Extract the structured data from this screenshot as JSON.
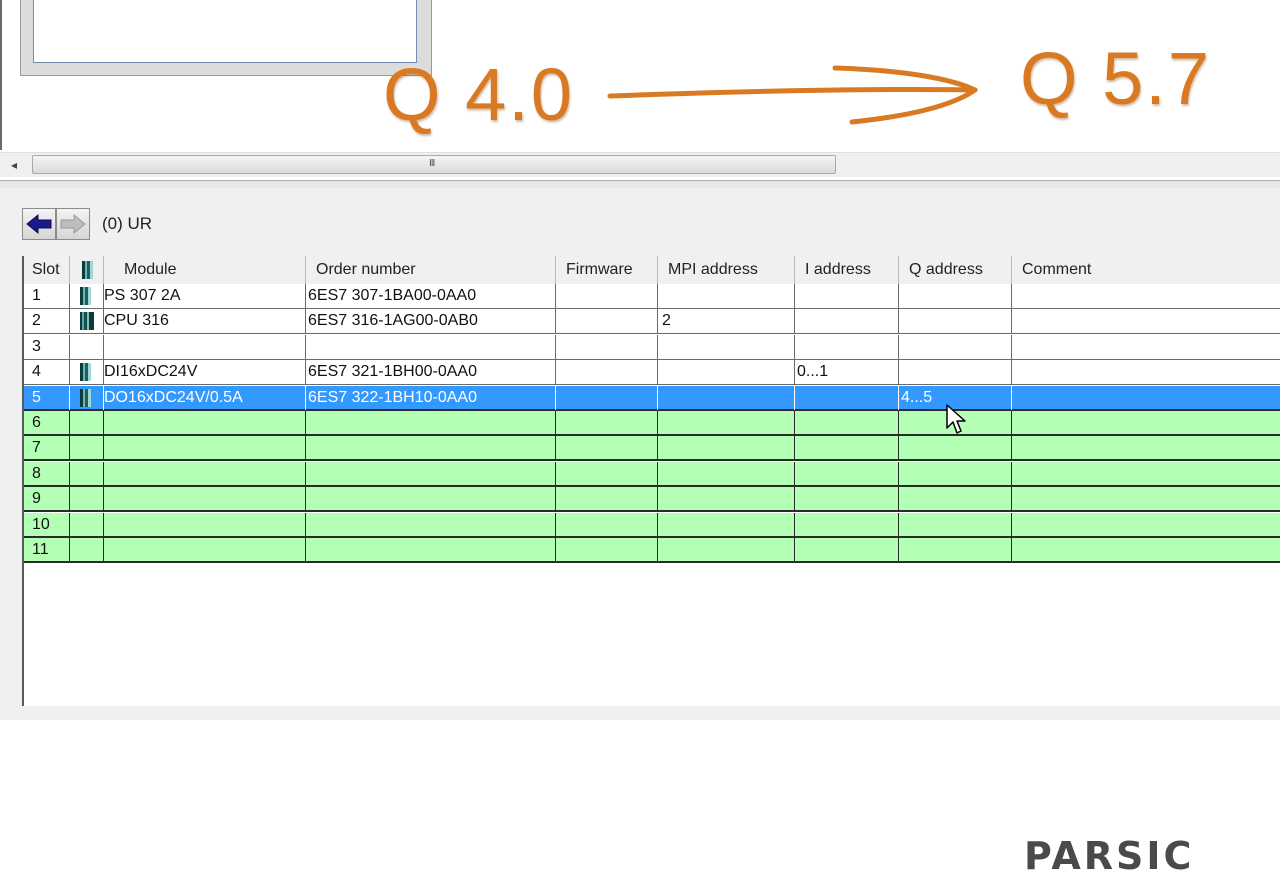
{
  "overlay": {
    "start_label": "Q 4.0",
    "end_label": "Q 5.7",
    "accent_color": "#d97a22"
  },
  "scrollbar": {
    "left_arrow": "◂",
    "grip": "III"
  },
  "nav": {
    "back_icon": "arrow-left-icon",
    "forward_icon": "arrow-right-icon",
    "rack_label": "(0)  UR"
  },
  "table": {
    "columns": [
      "Slot",
      "",
      "Module",
      "Order number",
      "Firmware",
      "MPI address",
      "I address",
      "Q address",
      "Comment"
    ],
    "rows": [
      {
        "slot": "1",
        "icon": "module-icon",
        "module": "PS 307 2A",
        "order": "6ES7 307-1BA00-0AA0",
        "firmware": "",
        "mpi": "",
        "i_addr": "",
        "q_addr": "",
        "comment": "",
        "state": "occupied"
      },
      {
        "slot": "2",
        "icon": "cpu-module-icon",
        "module": "CPU 316",
        "order": "6ES7 316-1AG00-0AB0",
        "firmware": "",
        "mpi": "2",
        "i_addr": "",
        "q_addr": "",
        "comment": "",
        "state": "occupied"
      },
      {
        "slot": "3",
        "icon": "",
        "module": "",
        "order": "",
        "firmware": "",
        "mpi": "",
        "i_addr": "",
        "q_addr": "",
        "comment": "",
        "state": "occupied"
      },
      {
        "slot": "4",
        "icon": "module-icon",
        "module": "DI16xDC24V",
        "order": "6ES7 321-1BH00-0AA0",
        "firmware": "",
        "mpi": "",
        "i_addr": "0...1",
        "q_addr": "",
        "comment": "",
        "state": "occupied"
      },
      {
        "slot": "5",
        "icon": "module-icon",
        "module": "DO16xDC24V/0.5A",
        "order": "6ES7 322-1BH10-0AA0",
        "firmware": "",
        "mpi": "",
        "i_addr": "",
        "q_addr": "4...5",
        "comment": "",
        "state": "selected"
      },
      {
        "slot": "6",
        "icon": "",
        "module": "",
        "order": "",
        "firmware": "",
        "mpi": "",
        "i_addr": "",
        "q_addr": "",
        "comment": "",
        "state": "available"
      },
      {
        "slot": "7",
        "icon": "",
        "module": "",
        "order": "",
        "firmware": "",
        "mpi": "",
        "i_addr": "",
        "q_addr": "",
        "comment": "",
        "state": "available"
      },
      {
        "slot": "8",
        "icon": "",
        "module": "",
        "order": "",
        "firmware": "",
        "mpi": "",
        "i_addr": "",
        "q_addr": "",
        "comment": "",
        "state": "available"
      },
      {
        "slot": "9",
        "icon": "",
        "module": "",
        "order": "",
        "firmware": "",
        "mpi": "",
        "i_addr": "",
        "q_addr": "",
        "comment": "",
        "state": "available"
      },
      {
        "slot": "10",
        "icon": "",
        "module": "",
        "order": "",
        "firmware": "",
        "mpi": "",
        "i_addr": "",
        "q_addr": "",
        "comment": "",
        "state": "available"
      },
      {
        "slot": "11",
        "icon": "",
        "module": "",
        "order": "",
        "firmware": "",
        "mpi": "",
        "i_addr": "",
        "q_addr": "",
        "comment": "",
        "state": "available"
      }
    ]
  },
  "colors": {
    "selected_row": "#3399ff",
    "available_slot": "#b3ffb3"
  },
  "logo": {
    "text": "PARSIC"
  }
}
